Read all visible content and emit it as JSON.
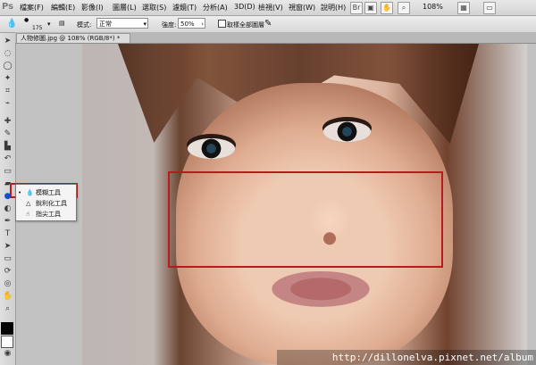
{
  "app": {
    "name": "Ps"
  },
  "menu": [
    "檔案(F)",
    "編輯(E)",
    "影像(I)",
    "圖層(L)",
    "選取(S)",
    "濾鏡(T)",
    "分析(A)",
    "3D(D)",
    "檢視(V)",
    "視窗(W)",
    "說明(H)"
  ],
  "top_controls": {
    "zoom": "108%"
  },
  "options": {
    "brush_size": "175",
    "mode_label": "模式:",
    "mode_value": "正常",
    "strength_label": "強度:",
    "strength_value": "50%",
    "sample_label": "取樣全部圖層"
  },
  "document": {
    "tab_title": "人物修圖.jpg @ 108% (RGB/8*) *"
  },
  "tool_flyout": {
    "items": [
      "模糊工具",
      "銳利化工具",
      "指尖工具"
    ]
  },
  "watermark": {
    "text": "http://dillonelva.pixnet.net/album"
  },
  "colors": {
    "selection_red": "#b71c1c",
    "ui_gray": "#d7d7d7"
  },
  "icons": {
    "active_tool": "blur-icon",
    "smudge": "smudge-icon"
  }
}
